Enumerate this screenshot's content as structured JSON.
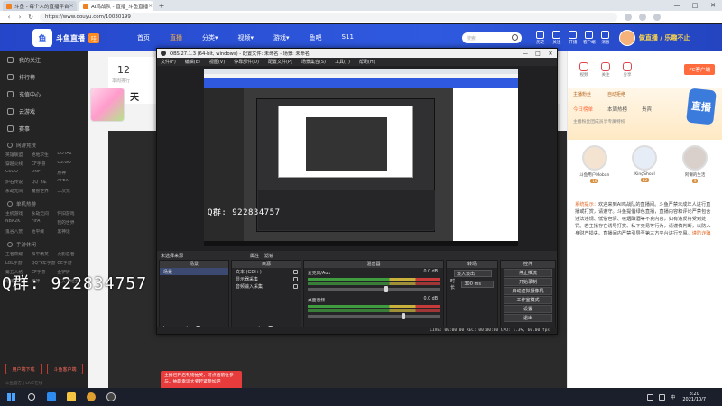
{
  "browser": {
    "tabs": [
      {
        "title": "斗鱼 - 每个人的直播平台",
        "active": false
      },
      {
        "title": "AI鸡战队 - 直播_斗鱼直播",
        "active": true
      }
    ],
    "close_glyph": "×",
    "new_tab_glyph": "+",
    "url": "https://www.douyu.com/10030199",
    "window_controls": [
      "—",
      "□",
      "✕"
    ]
  },
  "site": {
    "logo_text": "斗鱼直播",
    "logo_badge": "哇",
    "nav": [
      {
        "label": "首页",
        "active": false
      },
      {
        "label": "直播",
        "active": true
      },
      {
        "label": "分类▾",
        "active": false
      },
      {
        "label": "视频▾",
        "active": false
      },
      {
        "label": "游戏▾",
        "active": false
      },
      {
        "label": "鱼吧",
        "active": false
      },
      {
        "label": "S11",
        "active": false
      }
    ],
    "search_placeholder": "搜索",
    "header_icons": [
      "历史",
      "关注",
      "开播",
      "客户端",
      "消息"
    ],
    "promo_text": "做直播 / 乐趣不止"
  },
  "sidebar": {
    "items": [
      {
        "label": "我的关注",
        "icon": "heart-icon"
      },
      {
        "label": "排行榜",
        "icon": "trophy-icon"
      },
      {
        "label": "充值中心",
        "icon": "wallet-icon"
      },
      {
        "label": "云游戏",
        "icon": "cloud-icon"
      },
      {
        "label": "赛事",
        "icon": "cup-icon"
      }
    ],
    "sections": [
      {
        "title": "网游竞技",
        "items": [
          "英雄联盟",
          "绝地求生",
          "DOTA2",
          "穿越火线",
          "CF手游",
          "CS:GO",
          "CSGO",
          "DNF",
          "原神",
          "炉石传说",
          "QQ飞车",
          "APEX",
          "永劫无间",
          "魔兽世界",
          "二次元"
        ]
      },
      {
        "title": "单机热游",
        "items": [
          "主机游戏",
          "永劫无间",
          "怀旧游戏",
          "NBA2K",
          "FIFA",
          "我的世界",
          "鬼谷八荒",
          "地平线",
          "黑神话"
        ]
      },
      {
        "title": "手游休闲",
        "items": [
          "王者荣耀",
          "和平精英",
          "火影忍者",
          "LOL手游",
          "QQ飞车手游",
          "CC手游",
          "第五人格",
          "CF手游",
          "金铲铲",
          "暗黑不朽",
          "原神",
          "天天斗地主"
        ]
      }
    ],
    "btn_left": "用户端下载",
    "btn_right": "斗鱼客户端",
    "footer": "斗鱼官方  |  LIVE在线"
  },
  "room": {
    "rank_number": "12",
    "rank_label": "本周排行",
    "title_char": "天"
  },
  "gift_tip": "主播已开启礼物抽奖，可点击前往参与，抽取幸运大奖赶紧参加吧",
  "rail": {
    "icons": [
      "视频",
      "关注",
      "分享"
    ],
    "client_btn": "PC客户端",
    "promo_row": [
      "主播粉丝",
      "自动拒绝"
    ],
    "promo_tabs": [
      {
        "label": "今日榜单",
        "active": true
      },
      {
        "label": "本周热榜",
        "active": false
      },
      {
        "label": "贵宾",
        "active": false
      }
    ],
    "promo_sub": "主播粉丝团成员享专属特权",
    "promo_badge": "直播",
    "rankers": [
      {
        "name": "斗鱼用户Moban",
        "level": "16"
      },
      {
        "name": "KingShoul",
        "level": "12"
      },
      {
        "name": "阿懒的生活",
        "level": "9"
      }
    ],
    "notice_prefix": "系统提示：",
    "notice_body": "欢迎来到AI鸡战队的直播间。斗鱼严禁未成年人进行直播或打赏，请遵守。斗鱼提倡绿色直播，直播内容和评论严禁包含违法违规、低俗色情、吸烟酗酒等不良内容，如有违反将受到处罚。若主播存在诱导打赏、私下交易等行为，请谨慎判断，以防人身财产损失。直播间内严禁引导至第三方平台进行交易。",
    "notice_warn": "谨防诈骗"
  },
  "obs": {
    "title": "OBS 27.1.3 (64-bit, windows) - 配置文件: 未命名 - 场景: 未命名",
    "menu": [
      "文件(F)",
      "编辑(E)",
      "视图(V)",
      "停靠部件(D)",
      "配置文件(P)",
      "场景集合(S)",
      "工具(T)",
      "帮助(H)"
    ],
    "dock_tabs": [
      "场景",
      "来源",
      "混音器",
      "转场",
      "控件"
    ],
    "scene_name": "未选择来源",
    "scene_props": [
      "属性",
      "滤镜"
    ],
    "docks": {
      "scenes": {
        "title": "场景",
        "items": [
          "场景"
        ]
      },
      "sources": {
        "title": "来源",
        "items": [
          "文本 (GDI+)",
          "显示器采集",
          "音频输入采集"
        ]
      },
      "mixer": {
        "title": "混音器",
        "tracks": [
          {
            "name": "麦克风/Aux",
            "db": "0.0 dB",
            "level": 0.58
          },
          {
            "name": "桌面音频",
            "db": "0.0 dB",
            "level": 0.71
          }
        ]
      },
      "transitions": {
        "title": "转场",
        "type": "淡入淡出",
        "duration_label": "时长",
        "duration": "300 ms"
      },
      "controls": {
        "title": "控件",
        "buttons": [
          "停止推流",
          "开始录制",
          "启动虚拟摄像机",
          "工作室模式",
          "设置",
          "退出"
        ]
      }
    },
    "dock_foot": "+ − ▲ ▼",
    "status": "LIVE: 00:00:00   REC: 00:00:00   CPU: 1.3%, 60.00 fps",
    "qq_small": "Q群: 922834757"
  },
  "qq_overlay": "Q群: 922834757",
  "taskbar": {
    "tray": "中",
    "time": "8:20",
    "date": "2021/10/7"
  }
}
